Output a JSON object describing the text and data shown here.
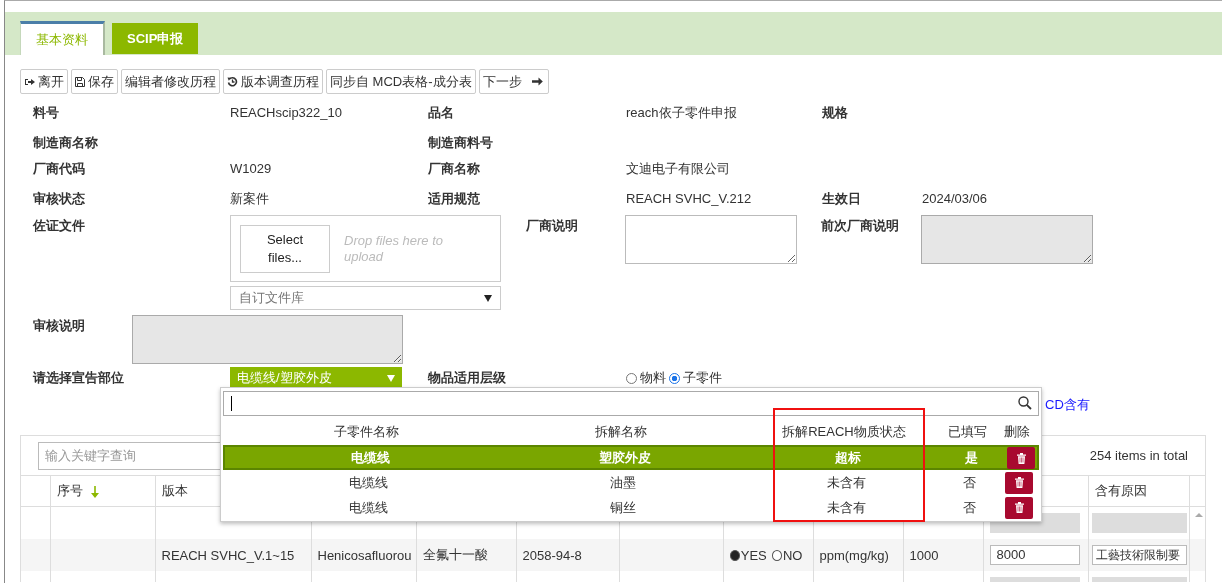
{
  "tabs": [
    {
      "label": "基本资料",
      "selected": true
    },
    {
      "label": "SCIP申报",
      "selected": false
    }
  ],
  "toolbar": [
    "离开",
    "保存",
    "编辑者修改历程",
    "版本调查历程",
    "同步自 MCD表格-成分表",
    "下一步"
  ],
  "form": [
    [
      {
        "label": "料号",
        "kind": "text",
        "value": "REACHscip322_10"
      },
      {
        "label": "品名",
        "kind": "text",
        "value": "reach依子零件申报"
      },
      {
        "label": "规格",
        "kind": "text"
      }
    ],
    [
      {
        "label": "制造商名称",
        "kind": "text"
      },
      {
        "label": "制造商料号",
        "kind": "text"
      }
    ],
    [
      {
        "label": "厂商代码",
        "kind": "text",
        "value": "W1029"
      },
      {
        "label": "厂商名称",
        "kind": "text",
        "value": "文迪电子有限公司"
      }
    ],
    [
      {
        "label": "审核状态",
        "kind": "text",
        "value": "新案件"
      },
      {
        "label": "适用规范",
        "kind": "text",
        "value": "REACH SVHC_V.212"
      },
      {
        "label": "生效日",
        "kind": "text",
        "value": "2024/03/06"
      }
    ],
    [
      {
        "label": "佐证文件",
        "kind": "upload",
        "button": "Select files...",
        "hint": "Drop files here to upload",
        "library": "自订文件库"
      },
      {
        "label": "厂商说明",
        "kind": "textarea",
        "disabled": false
      },
      {
        "label": "前次厂商说明",
        "kind": "textarea",
        "disabled": true
      }
    ],
    [
      {
        "label": "审核说明",
        "kind": "textarea",
        "disabled": true
      }
    ],
    [
      {
        "label": "请选择宣告部位",
        "kind": "select",
        "value": "电缆线/塑胶外皮"
      },
      {
        "label": "物品适用层级",
        "kind": "radio",
        "options": [
          {
            "label": "物料",
            "selected": false
          },
          {
            "label": "子零件",
            "selected": true
          }
        ]
      }
    ]
  ],
  "link": "CD含有",
  "part_picker": {
    "columns": [
      "子零件名称",
      "拆解名称",
      "拆解REACH物质状态",
      "已填写",
      "删除"
    ],
    "rows": [
      {
        "part": "电缆线",
        "component": "塑胶外皮",
        "status": "超标",
        "filled": "是",
        "selected": true
      },
      {
        "part": "电缆线",
        "component": "油墨",
        "status": "未含有",
        "filled": "否",
        "selected": false
      },
      {
        "part": "电缆线",
        "component": "铜丝",
        "status": "未含有",
        "filled": "否",
        "selected": false
      }
    ]
  },
  "grid": {
    "search_placeholder": "输入关键字查询",
    "total": "254 items in total",
    "columns": [
      {},
      {
        "label": "序号",
        "sorted": true
      },
      {
        "label": "版本"
      },
      {},
      {},
      {},
      {},
      {},
      {},
      {},
      {},
      {
        "label": "含有原因"
      }
    ],
    "rows": [
      {
        "cells": [
          null,
          null,
          null,
          null,
          null,
          null,
          null,
          null,
          null,
          null,
          {
            "kind": "field",
            "disabled": true
          },
          {
            "kind": "field",
            "disabled": true
          }
        ]
      },
      {
        "cells": [
          null,
          null,
          "REACH SVHC_V.1~15",
          "Henicosafluorou",
          "全氟十一酸",
          "2058-94-8",
          null,
          {
            "kind": "yesno",
            "options": [
              {
                "label": "YES",
                "selected": true
              },
              {
                "label": "NO",
                "selected": false
              }
            ]
          },
          "ppm(mg/kg)",
          "1000",
          {
            "kind": "field",
            "value": "8000",
            "disabled": false
          },
          {
            "kind": "field",
            "value": "工藝技術限制要",
            "disabled": false
          }
        ]
      },
      {
        "cells": [
          null,
          null,
          null,
          null,
          null,
          null,
          null,
          null,
          null,
          null,
          {
            "kind": "field",
            "disabled": true
          },
          {
            "kind": "field",
            "disabled": true
          }
        ]
      }
    ]
  }
}
